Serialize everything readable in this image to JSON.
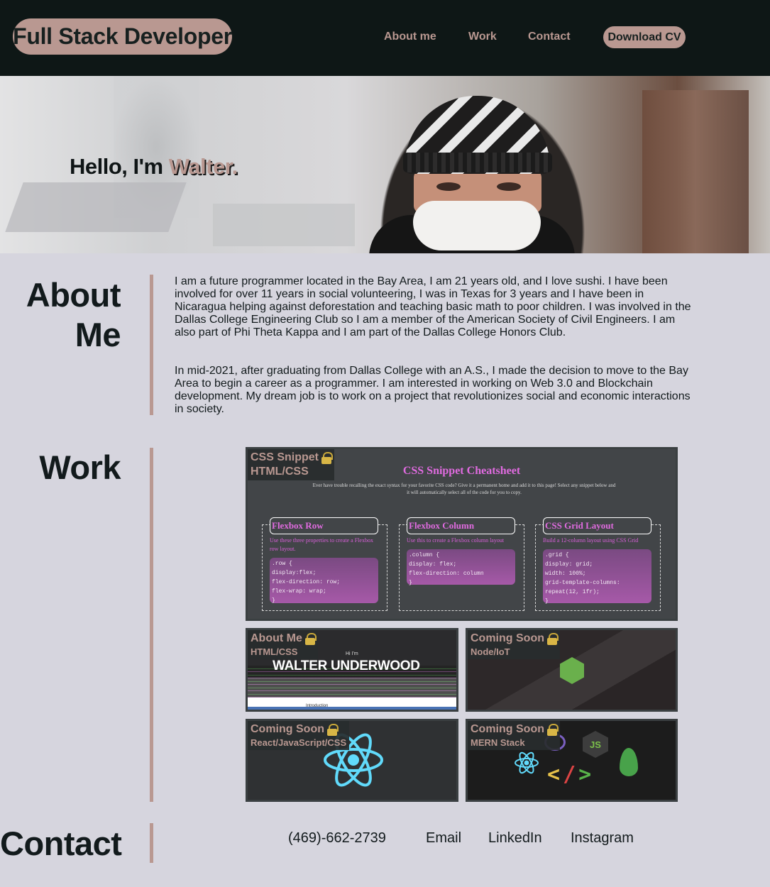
{
  "nav": {
    "brand": "Full Stack Developer",
    "links": [
      "About me",
      "Work",
      "Contact"
    ],
    "cv_button": "Download CV"
  },
  "hero": {
    "greeting": "Hello, I'm ",
    "name": "Walter."
  },
  "about": {
    "title_line1": "About",
    "title_line2": "Me",
    "paragraphs": [
      "I am a future programmer located in the Bay Area, I am 21 years old, and I love sushi. I have been involved for over 11 years in social volunteering, I was in Texas for 3 years and I have been in Nicaragua helping against deforestation and teaching basic math to poor children. I was involved in the Dallas College Engineering Club so I am a member of the American Society of Civil Engineers. I am also part of Phi Theta Kappa and I am part of the Dallas College Honors Club.",
      "In mid-2021, after graduating from Dallas College with an A.S., I made the decision to move to the Bay Area to begin a career as a programmer. I am interested in working on Web 3.0 and Blockchain development. My dream job is to work on a project that revolutionizes social and economic interactions in society."
    ]
  },
  "work": {
    "title": "Work",
    "projects": [
      {
        "title": "CSS Snippet",
        "stack": "HTML/CSS",
        "icon": "lock-icon"
      },
      {
        "title": "About Me",
        "stack": "HTML/CSS",
        "icon": "lock-icon"
      },
      {
        "title": "Coming Soon",
        "stack": "Node/IoT",
        "icon": "lock-icon"
      },
      {
        "title": "Coming Soon",
        "stack": "React/JavaScript/CSS",
        "icon": "lock-icon"
      },
      {
        "title": "Coming Soon",
        "stack": "MERN Stack",
        "icon": "lock-icon"
      }
    ],
    "css_snippet_preview": {
      "heading": "CSS Snippet Cheatsheet",
      "description": "Ever have trouble recalling the exact syntax for your favorite CSS code? Give it a permanent home and add it to this page! Select any snippet below and it will automatically select all of the code for you to copy.",
      "snippets": [
        {
          "name": "Flexbox Row",
          "desc": "Use these three properties to create a Flexbox row layout.",
          "code": ".row {\ndisplay:flex;\nflex-direction: row;\nflex-wrap: wrap;\n}"
        },
        {
          "name": "Flexbox Column",
          "desc": "Use this to create a Flexbox column layout",
          "code": ".column {\ndisplay: flex;\nflex-direction: column\n}"
        },
        {
          "name": "CSS Grid Layout",
          "desc": "Build a 12-column layout using CSS Grid",
          "code": ".grid {\ndisplay: grid;\nwidth: 100%;\ngrid-template-columns:\nrepeat(12, 1fr);\n}"
        }
      ]
    },
    "about_me_preview": {
      "hi": "Hi I'm",
      "name": "WALTER UNDERWOOD",
      "intro": "Introduction"
    },
    "mern_preview": {
      "js_badge": "JS",
      "brackets": [
        "<",
        "/",
        ">"
      ]
    }
  },
  "contact": {
    "title": "Contact",
    "links": [
      "(469)-662-2739",
      "Email",
      "LinkedIn",
      "Instagram"
    ]
  },
  "colors": {
    "accent": "#b99891",
    "nav_bg": "#0e1716",
    "page_bg": "#d6d5de",
    "text": "#121a1c"
  }
}
